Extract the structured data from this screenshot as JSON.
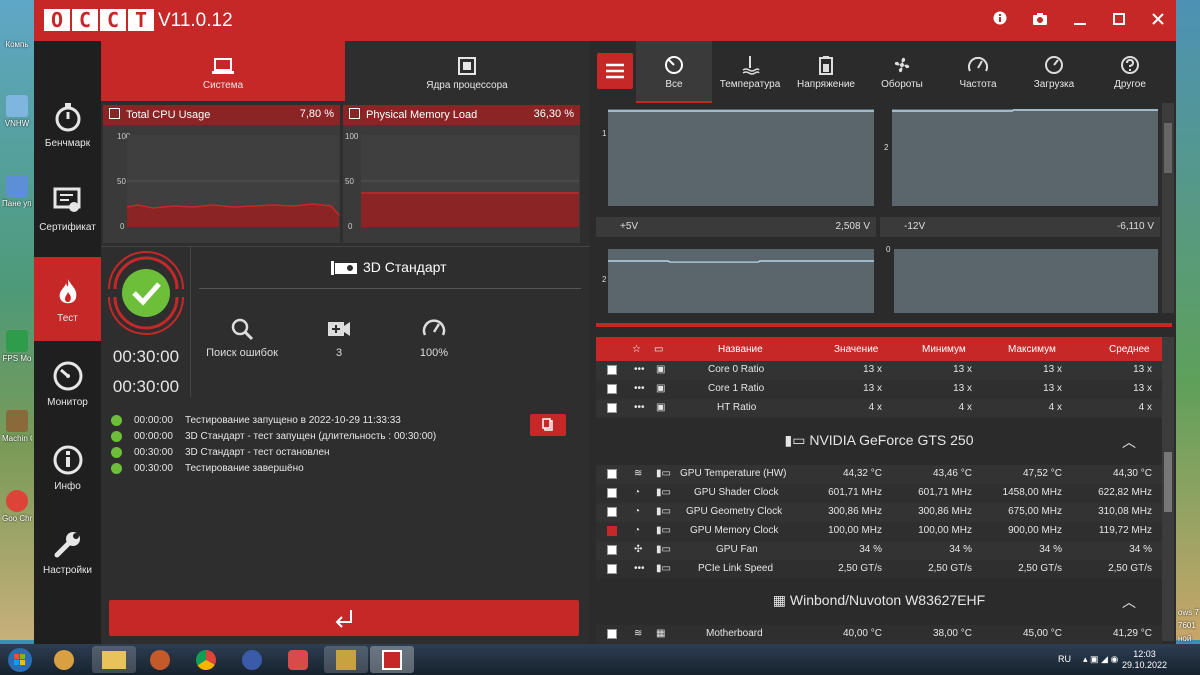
{
  "app": {
    "logo_letters": [
      "O",
      "C",
      "C",
      "T"
    ],
    "version": "V11.0.12"
  },
  "titlebar_icons": [
    "info-icon",
    "camera-icon",
    "minimize-icon",
    "maximize-icon",
    "close-icon"
  ],
  "sidebar": [
    {
      "label": "Бенчмарк",
      "icon": "stopwatch-icon"
    },
    {
      "label": "Сертификат",
      "icon": "certificate-icon"
    },
    {
      "label": "Тест",
      "icon": "flame-icon",
      "active": true
    },
    {
      "label": "Монитор",
      "icon": "gauge-icon"
    },
    {
      "label": "Инфо",
      "icon": "info-icon"
    },
    {
      "label": "Настройки",
      "icon": "wrench-icon"
    }
  ],
  "left_tabs": [
    {
      "label": "Система",
      "active": true
    },
    {
      "label": "Ядра процессора",
      "active": false
    }
  ],
  "mini_charts": [
    {
      "title": "Total CPU Usage",
      "value": "7,80 %",
      "ticks": [
        "100",
        "50",
        "0"
      ],
      "level_percent": 7.8
    },
    {
      "title": "Physical Memory Load",
      "value": "36,30 %",
      "ticks": [
        "100",
        "50",
        "0"
      ],
      "level_percent": 36.3
    }
  ],
  "test": {
    "name": "3D Стандарт",
    "timer_elapsed": "00:30:00",
    "timer_total": "00:30:00",
    "options": [
      {
        "label": "Поиск ошибок",
        "icon": "search-icon"
      },
      {
        "label": "3",
        "icon": "shader-icon"
      },
      {
        "label": "100%",
        "icon": "gauge-icon"
      }
    ]
  },
  "log": [
    {
      "time": "00:00:00",
      "text": "Тестирование запущено в 2022-10-29 11:33:33"
    },
    {
      "time": "00:00:00",
      "text": "3D Стандарт - тест запущен (длительность : 00:30:00)"
    },
    {
      "time": "00:30:00",
      "text": "3D Стандарт - тест остановлен"
    },
    {
      "time": "00:30:00",
      "text": "Тестирование завершёно"
    }
  ],
  "right_tabs": [
    {
      "label": "Все",
      "icon": "all-icon",
      "active": true
    },
    {
      "label": "Температура",
      "icon": "temperature-icon"
    },
    {
      "label": "Напряжение",
      "icon": "battery-icon"
    },
    {
      "label": "Обороты",
      "icon": "fan-icon"
    },
    {
      "label": "Частота",
      "icon": "frequency-icon"
    },
    {
      "label": "Загрузка",
      "icon": "load-icon"
    },
    {
      "label": "Другое",
      "icon": "question-icon"
    }
  ],
  "sensor_graphs": [
    {
      "label": "+5V",
      "value": "2,508 V",
      "tick": "1"
    },
    {
      "label": "-12V",
      "value": "-6,110 V",
      "tick": "2"
    },
    {
      "label": "",
      "value": "",
      "tick": "2"
    },
    {
      "label": "",
      "value": "",
      "tick": "0"
    }
  ],
  "table": {
    "headers": [
      "Название",
      "Значение",
      "Минимум",
      "Максимум",
      "Среднее"
    ],
    "cpu_rows": [
      {
        "name": "Core 0 Ratio",
        "value": "13 x",
        "min": "13 x",
        "max": "13 x",
        "avg": "13 x"
      },
      {
        "name": "Core 1 Ratio",
        "value": "13 x",
        "min": "13 x",
        "max": "13 x",
        "avg": "13 x"
      },
      {
        "name": "HT Ratio",
        "value": "4 x",
        "min": "4 x",
        "max": "4 x",
        "avg": "4 x"
      }
    ],
    "gpu_group": "NVIDIA GeForce GTS 250",
    "gpu_rows": [
      {
        "name": "GPU Temperature (HW)",
        "value": "44,32 °C",
        "min": "43,46 °C",
        "max": "47,52 °C",
        "avg": "44,30 °C",
        "checked": false
      },
      {
        "name": "GPU Shader Clock",
        "value": "601,71 MHz",
        "min": "601,71 MHz",
        "max": "1458,00 MHz",
        "avg": "622,82 MHz",
        "checked": false
      },
      {
        "name": "GPU Geometry Clock",
        "value": "300,86 MHz",
        "min": "300,86 MHz",
        "max": "675,00 MHz",
        "avg": "310,08 MHz",
        "checked": false
      },
      {
        "name": "GPU Memory Clock",
        "value": "100,00 MHz",
        "min": "100,00 MHz",
        "max": "900,00 MHz",
        "avg": "119,72 MHz",
        "checked": true
      },
      {
        "name": "GPU Fan",
        "value": "34 %",
        "min": "34 %",
        "max": "34 %",
        "avg": "34 %",
        "checked": false
      },
      {
        "name": "PCIe Link Speed",
        "value": "2,50 GT/s",
        "min": "2,50 GT/s",
        "max": "2,50 GT/s",
        "avg": "2,50 GT/s",
        "checked": false
      }
    ],
    "mb_group": "Winbond/Nuvoton W83627EHF",
    "mb_rows": [
      {
        "name": "Motherboard",
        "value": "40,00 °C",
        "min": "38,00 °C",
        "max": "45,00 °C",
        "avg": "41,29 °C"
      }
    ]
  },
  "desktop_icons": [
    "Компь",
    "VNHW",
    "Пане управ",
    "FPS Mo",
    "Machin Collecto",
    "Goo Chro"
  ],
  "desktop_right": [
    "ows 7",
    "7601",
    "ной"
  ],
  "taskbar": {
    "lang": "RU",
    "time": "12:03",
    "date": "29.10.2022"
  }
}
